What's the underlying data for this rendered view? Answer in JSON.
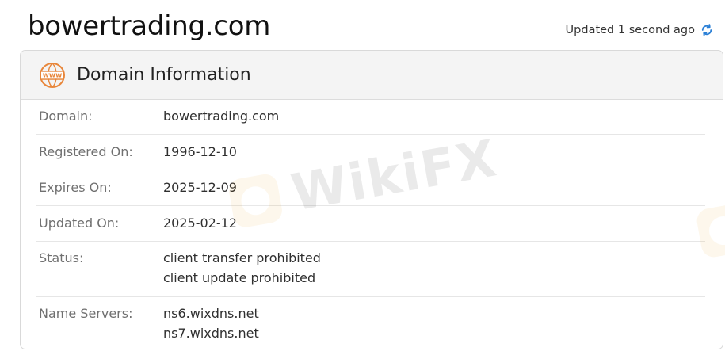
{
  "page_title": "bowertrading.com",
  "updated_text": "Updated 1 second ago",
  "card": {
    "title": "Domain Information",
    "icon_label": "WWW"
  },
  "rows": [
    {
      "label": "Domain:",
      "values": [
        "bowertrading.com"
      ]
    },
    {
      "label": "Registered On:",
      "values": [
        "1996-12-10"
      ]
    },
    {
      "label": "Expires On:",
      "values": [
        "2025-12-09"
      ]
    },
    {
      "label": "Updated On:",
      "values": [
        "2025-02-12"
      ]
    },
    {
      "label": "Status:",
      "values": [
        "client transfer prohibited",
        "client update prohibited"
      ]
    },
    {
      "label": "Name Servers:",
      "values": [
        "ns6.wixdns.net",
        "ns7.wixdns.net"
      ]
    }
  ],
  "watermark_text": "WikiFX",
  "colors": {
    "accent_refresh": "#2a7fd6",
    "www_icon": "#e8863a"
  }
}
